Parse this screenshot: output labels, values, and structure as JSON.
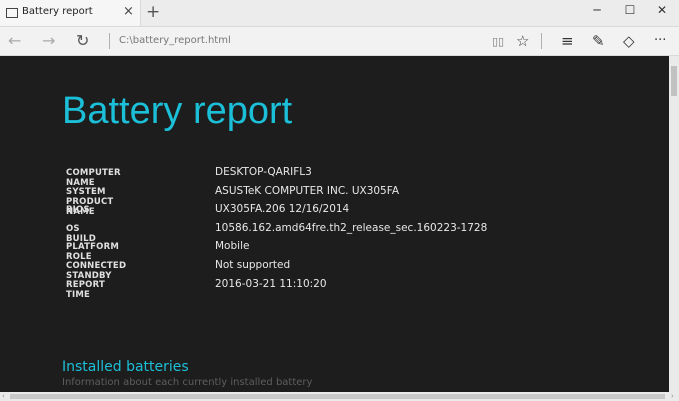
{
  "browser": {
    "tab": {
      "title": "Battery report"
    },
    "address": "C:\\battery_report.html",
    "icons": {
      "page": "page-icon",
      "close": "×",
      "new_tab": "+",
      "minimize": "─",
      "maximize": "☐",
      "window_close": "✕",
      "back": "←",
      "forward": "→",
      "refresh": "↻",
      "reading": "▯▯",
      "favorite": "☆",
      "hub": "≡",
      "note": "✎",
      "share": "◇",
      "more": "···"
    }
  },
  "report": {
    "title": "Battery report",
    "rows": [
      {
        "label": "COMPUTER NAME",
        "value": "DESKTOP-QARIFL3"
      },
      {
        "label": "SYSTEM PRODUCT NAME",
        "value": "ASUSTeK COMPUTER INC. UX305FA"
      },
      {
        "label": "BIOS",
        "value": "UX305FA.206 12/16/2014"
      },
      {
        "label": "OS BUILD",
        "value": "10586.162.amd64fre.th2_release_sec.160223-1728"
      },
      {
        "label": "PLATFORM ROLE",
        "value": "Mobile"
      },
      {
        "label": "CONNECTED STANDBY",
        "value": "Not supported"
      },
      {
        "label": "REPORT TIME",
        "value": "2016-03-21  11:10:20"
      }
    ],
    "installed": {
      "title": "Installed batteries",
      "subtitle": "Information about each currently installed battery"
    }
  },
  "colors": {
    "accent": "#1cbfd8",
    "background": "#1d1d1d"
  }
}
